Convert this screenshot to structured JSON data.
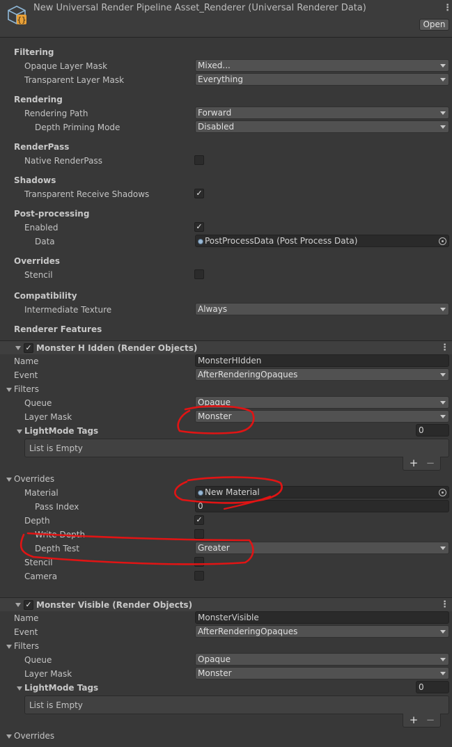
{
  "header": {
    "title": "New Universal Render Pipeline Asset_Renderer (Universal Renderer Data)",
    "open_label": "Open"
  },
  "filtering": {
    "title": "Filtering",
    "opaque_label": "Opaque Layer Mask",
    "opaque_value": "Mixed...",
    "transparent_label": "Transparent Layer Mask",
    "transparent_value": "Everything"
  },
  "rendering": {
    "title": "Rendering",
    "path_label": "Rendering Path",
    "path_value": "Forward",
    "depth_priming_label": "Depth Priming Mode",
    "depth_priming_value": "Disabled"
  },
  "renderpass": {
    "title": "RenderPass",
    "native_label": "Native RenderPass",
    "native_checked": false
  },
  "shadows": {
    "title": "Shadows",
    "transparent_receive_label": "Transparent Receive Shadows",
    "transparent_receive_checked": true
  },
  "post_processing": {
    "title": "Post-processing",
    "enabled_label": "Enabled",
    "enabled_checked": true,
    "data_label": "Data",
    "data_value": "PostProcessData (Post Process Data)"
  },
  "overrides_top": {
    "title": "Overrides",
    "stencil_label": "Stencil",
    "stencil_checked": false
  },
  "compatibility": {
    "title": "Compatibility",
    "intermediate_label": "Intermediate Texture",
    "intermediate_value": "Always"
  },
  "renderer_features_title": "Renderer Features",
  "feature1": {
    "header": "Monster H Idden (Render Objects)",
    "name_label": "Name",
    "name_value": "MonsterHIdden",
    "event_label": "Event",
    "event_value": "AfterRenderingOpaques",
    "filters_label": "Filters",
    "queue_label": "Queue",
    "queue_value": "Opaque",
    "layer_mask_label": "Layer Mask",
    "layer_mask_value": "Monster",
    "lightmode_label": "LightMode Tags",
    "lightmode_count": "0",
    "list_empty": "List is Empty",
    "overrides_label": "Overrides",
    "material_label": "Material",
    "material_value": "New Material",
    "pass_index_label": "Pass Index",
    "pass_index_value": "0",
    "depth_label": "Depth",
    "depth_checked": true,
    "write_depth_label": "Write Depth",
    "write_depth_checked": false,
    "depth_test_label": "Depth Test",
    "depth_test_value": "Greater",
    "stencil_label": "Stencil",
    "stencil_checked": false,
    "camera_label": "Camera",
    "camera_checked": false
  },
  "feature2": {
    "header": "Monster Visible (Render Objects)",
    "name_label": "Name",
    "name_value": "MonsterVisible",
    "event_label": "Event",
    "event_value": "AfterRenderingOpaques",
    "filters_label": "Filters",
    "queue_label": "Queue",
    "queue_value": "Opaque",
    "layer_mask_label": "Layer Mask",
    "layer_mask_value": "Monster",
    "lightmode_label": "LightMode Tags",
    "lightmode_count": "0",
    "list_empty": "List is Empty",
    "overrides_label": "Overrides"
  },
  "icons": {
    "asset": "renderer-asset-icon",
    "menu": "kebab-menu-icon",
    "fold": "foldout-arrow-icon",
    "check": "checkmark-icon",
    "plus": "plus-icon",
    "minus": "minus-icon",
    "picker": "object-picker-icon"
  },
  "colors": {
    "background": "#383838",
    "field": "#2a2a2a",
    "dropdown": "#515151",
    "annotation": "#e11414",
    "accent": "#e8a038"
  }
}
